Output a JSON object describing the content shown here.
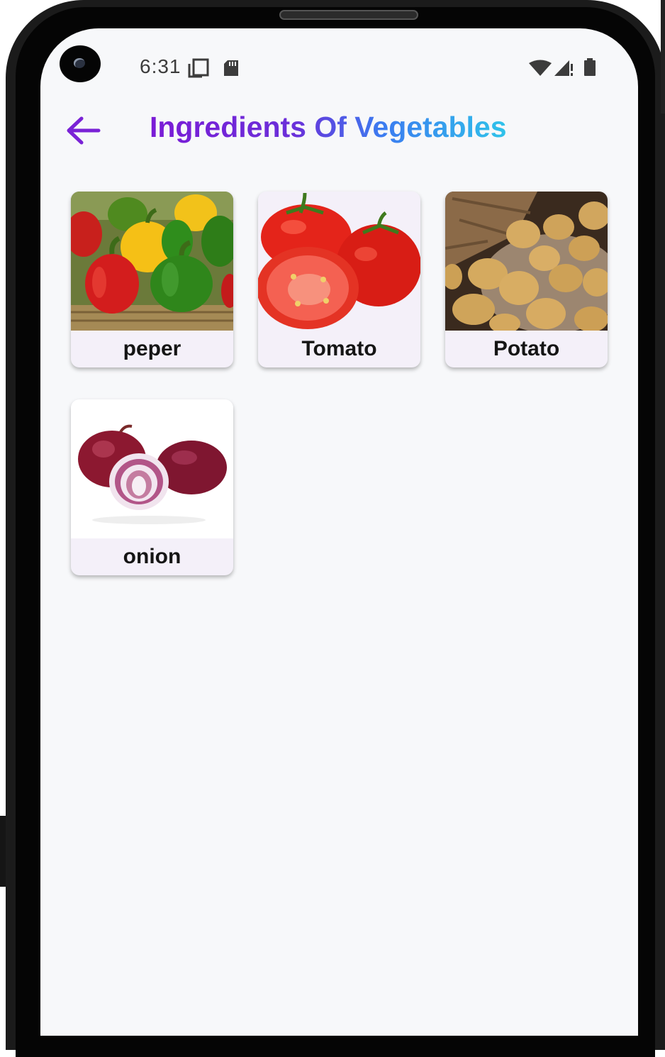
{
  "status_bar": {
    "time": "6:31",
    "icons": [
      "screen-rotate-icon",
      "sd-card-icon",
      "wifi-icon",
      "signal-icon",
      "battery-icon"
    ]
  },
  "app_bar": {
    "back_icon": "arrow-left-icon",
    "title": "Ingredients Of Vegetables"
  },
  "colors": {
    "title_gradient": [
      "#7a1bd6",
      "#3b7bf0",
      "#2fc3ea"
    ],
    "back_arrow": "#7a22d6",
    "card_background": "#f4f0f9",
    "screen_background": "#f7f8fa"
  },
  "items": [
    {
      "label": "peper",
      "image": "bell-peppers-image"
    },
    {
      "label": "Tomato",
      "image": "tomatoes-image"
    },
    {
      "label": "Potato",
      "image": "potatoes-image"
    },
    {
      "label": "onion",
      "image": "onions-image"
    }
  ]
}
